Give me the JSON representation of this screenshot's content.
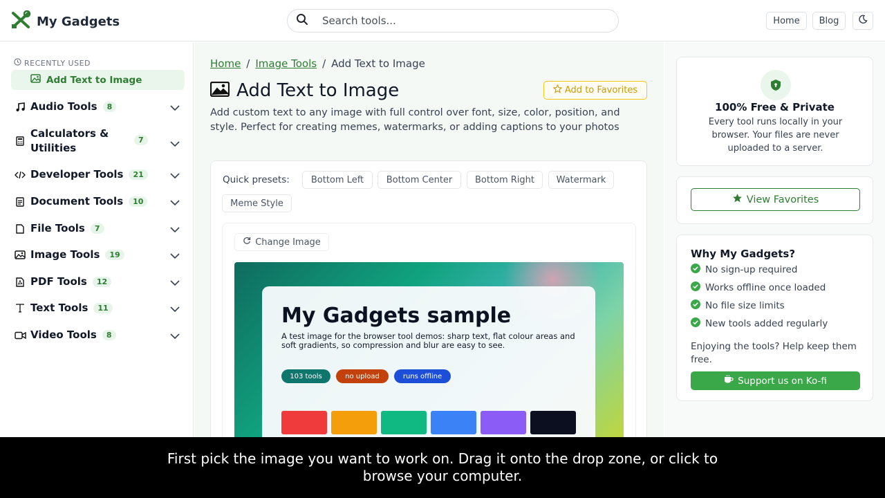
{
  "header": {
    "brand": "My Gadgets",
    "search_placeholder": "Search tools...",
    "nav": [
      "Home",
      "Blog"
    ]
  },
  "sidebar": {
    "recent_label": "RECENTLY USED",
    "recent_item": "Add Text to Image",
    "categories": [
      {
        "label": "Audio Tools",
        "count": "8",
        "icon": "music-icon"
      },
      {
        "label": "Calculators & Utilities",
        "count": "7",
        "icon": "calculator-icon"
      },
      {
        "label": "Developer Tools",
        "count": "21",
        "icon": "code-icon"
      },
      {
        "label": "Document Tools",
        "count": "10",
        "icon": "document-icon"
      },
      {
        "label": "File Tools",
        "count": "7",
        "icon": "folder-icon"
      },
      {
        "label": "Image Tools",
        "count": "19",
        "icon": "image-icon"
      },
      {
        "label": "PDF Tools",
        "count": "12",
        "icon": "pdf-icon"
      },
      {
        "label": "Text Tools",
        "count": "11",
        "icon": "text-icon"
      },
      {
        "label": "Video Tools",
        "count": "8",
        "icon": "video-icon"
      }
    ]
  },
  "main": {
    "breadcrumb": [
      "Home",
      "Image Tools",
      "Add Text to Image"
    ],
    "title": "Add Text to Image",
    "favorites_button": "Add to Favorites",
    "description": "Add custom text to any image with full control over font, size, color, position, and style. Perfect for creating memes, watermarks, or adding captions to your photos",
    "presets_label": "Quick presets:",
    "presets": [
      "Bottom Left",
      "Bottom Center",
      "Bottom Right",
      "Watermark",
      "Meme Style"
    ],
    "change_image": "Change Image",
    "preview": {
      "title": "My Gadgets sample",
      "text": "A test image for the browser tool demos: sharp text, flat colour areas and soft gradients, so compression and blur are easy to see.",
      "pills": [
        "103 tools",
        "no upload",
        "runs offline"
      ],
      "pill_colors": [
        "#0f766e",
        "#c2410c",
        "#1d4ed8"
      ],
      "swatches": [
        "#ef3b3b",
        "#f59e0b",
        "#10b981",
        "#3b82f6",
        "#8b5cf6",
        "#0b0f1f"
      ]
    }
  },
  "right": {
    "free_title": "100% Free & Private",
    "free_text": "Every tool runs locally in your browser. Your files are never uploaded to a server.",
    "view_favorites": "View Favorites",
    "why_title": "Why My Gadgets?",
    "why_items": [
      "No sign-up required",
      "Works offline once loaded",
      "No file size limits",
      "New tools added regularly"
    ],
    "enjoy_text": "Enjoying the tools? Help keep them free.",
    "kofi_button": "Support us on Ko-fi"
  },
  "caption": "First pick the image you want to work on. Drag it onto the drop zone, or click to browse your computer.",
  "colors": {
    "accent": "#2e7d32",
    "favorite": "#f5c518",
    "kofi": "#3aa748"
  }
}
